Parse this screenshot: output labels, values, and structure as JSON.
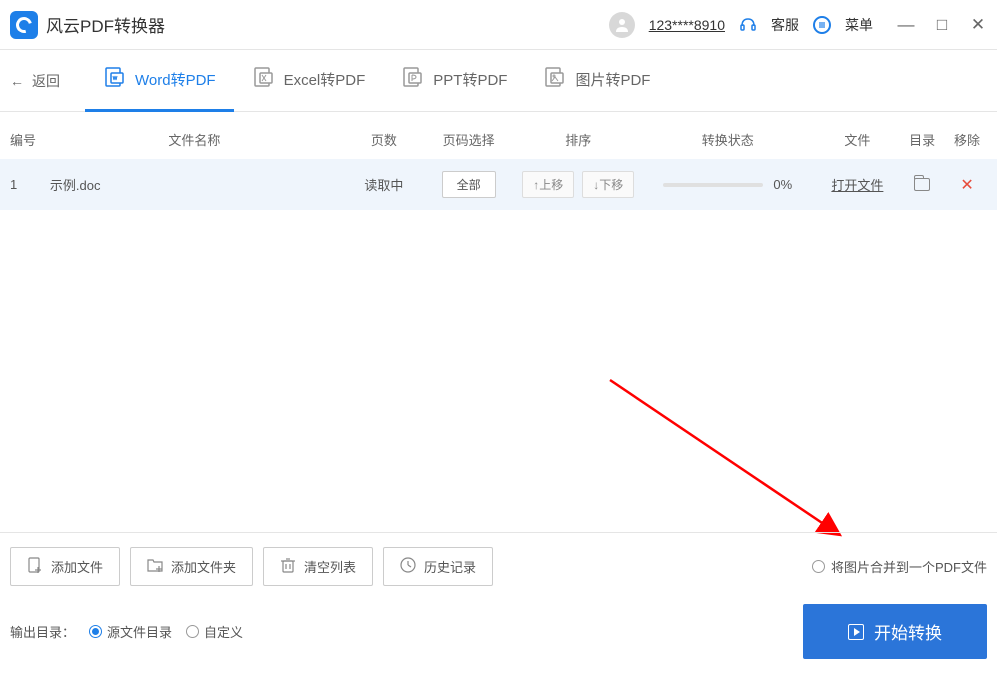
{
  "app": {
    "title": "风云PDF转换器"
  },
  "header": {
    "user": "123****8910",
    "service": "客服",
    "menu": "菜单"
  },
  "nav": {
    "back": "返回",
    "tabs": [
      {
        "label": "Word转PDF",
        "active": true
      },
      {
        "label": "Excel转PDF",
        "active": false
      },
      {
        "label": "PPT转PDF",
        "active": false
      },
      {
        "label": "图片转PDF",
        "active": false
      }
    ]
  },
  "columns": {
    "idx": "编号",
    "name": "文件名称",
    "pages": "页数",
    "select": "页码选择",
    "sort": "排序",
    "status": "转换状态",
    "file": "文件",
    "dir": "目录",
    "remove": "移除"
  },
  "rows": [
    {
      "idx": "1",
      "name": "示例.doc",
      "pages": "读取中",
      "select": "全部",
      "up": "↑上移",
      "down": "↓下移",
      "percent": "0%",
      "open": "打开文件"
    }
  ],
  "footer": {
    "actions": {
      "addFile": "添加文件",
      "addFolder": "添加文件夹",
      "clear": "清空列表",
      "history": "历史记录"
    },
    "merge": "将图片合并到一个PDF文件",
    "outputLabel": "输出目录：",
    "sourceDir": "源文件目录",
    "custom": "自定义",
    "convert": "开始转换"
  }
}
